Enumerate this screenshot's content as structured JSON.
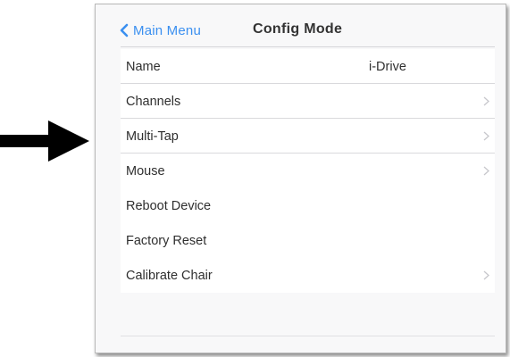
{
  "nav": {
    "back_label": "Main Menu",
    "title": "Config Mode"
  },
  "settings": {
    "rows": [
      {
        "label": "Name",
        "value": "i-Drive",
        "chevron": false
      },
      {
        "label": "Channels",
        "value": "",
        "chevron": true
      },
      {
        "label": "Multi-Tap",
        "value": "",
        "chevron": true
      },
      {
        "label": "Mouse",
        "value": "",
        "chevron": true
      },
      {
        "label": "Reboot Device",
        "value": "",
        "chevron": false
      },
      {
        "label": "Factory Reset",
        "value": "",
        "chevron": false
      },
      {
        "label": "Calibrate Chair",
        "value": "",
        "chevron": true
      }
    ]
  },
  "colors": {
    "accent": "#3a8ff0",
    "arrow": "#000000",
    "chevron": "#c7c7cc",
    "text": "#2f2f2f"
  },
  "icons": {
    "pointer": "right-arrow-icon",
    "back": "chevron-left-icon",
    "disclosure": "chevron-right-icon"
  }
}
